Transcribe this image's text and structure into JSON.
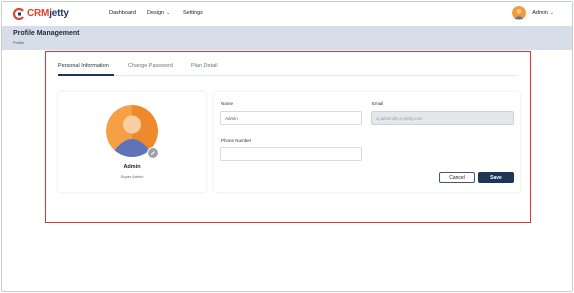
{
  "brand": {
    "crm": "CRM",
    "jetty": "jetty"
  },
  "nav": {
    "dashboard": "Dashboard",
    "design": "Design",
    "settings": "Settings"
  },
  "user": {
    "name": "Admin"
  },
  "header": {
    "title": "Profile Management",
    "breadcrumb": "Profile"
  },
  "tabs": [
    {
      "label": "Personal Information",
      "active": true
    },
    {
      "label": "Change Password",
      "active": false
    },
    {
      "label": "Plan Detail",
      "active": false
    }
  ],
  "profile": {
    "name": "Admin",
    "role": "Super Admin"
  },
  "form": {
    "name_label": "Name",
    "name_value": "Admin",
    "email_label": "Email",
    "email_value": "cj.admin@crmjetty.com",
    "phone_label": "Phone Number",
    "phone_value": "",
    "cancel_label": "Cancel",
    "save_label": "Save"
  },
  "colors": {
    "brand_red": "#e8402c",
    "brand_navy": "#1d3557",
    "highlight": "#e0343a",
    "header_bg": "#d7dde9"
  },
  "icons": [
    "crmjetty-logo-icon",
    "chevron-down-icon",
    "user-avatar-icon",
    "pencil-icon"
  ]
}
